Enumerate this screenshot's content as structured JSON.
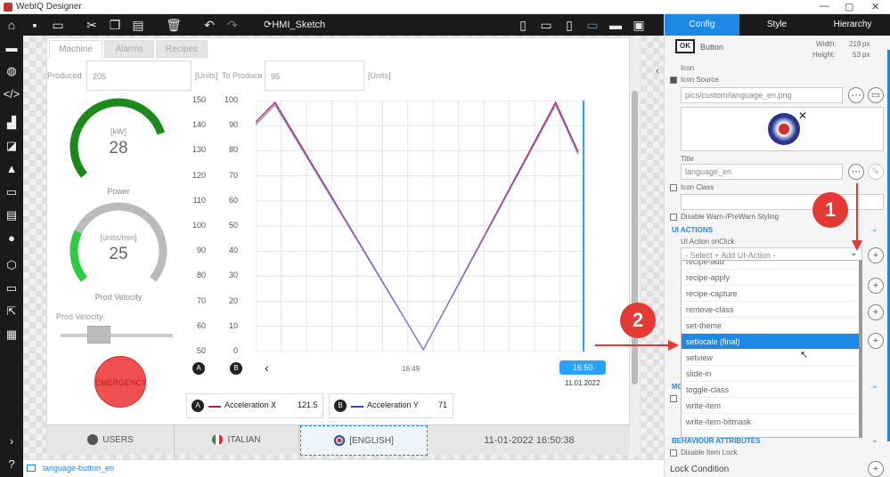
{
  "app": {
    "title": "WebIQ Designer",
    "window_controls": [
      "—",
      "▢",
      "✕"
    ]
  },
  "toolbar": {
    "project_name": "HMI_Sketch"
  },
  "hmi": {
    "tabs": [
      {
        "label": "Machine"
      },
      {
        "label": "Alarms"
      },
      {
        "label": "Recipes"
      }
    ],
    "produced_label": "Produced",
    "produced_value": "205",
    "produced_units": "[Units]",
    "to_produce_label": "To Produce",
    "to_produce_value": "95",
    "to_produce_units": "[Units]",
    "gauge_power": {
      "unit": "[kW]",
      "value": "28",
      "title": "Power",
      "fraction": 0.78,
      "color": "#1b8a1b"
    },
    "gauge_velocity": {
      "unit": "[units/min]",
      "value": "25",
      "title": "Prod Velocity",
      "fraction": 0.25,
      "color": "#2ecc40"
    },
    "slider": {
      "label": "Prod Velocity",
      "fraction": 0.3
    },
    "emergency_label": "EMERGENCY",
    "time_label": "16:49",
    "cursor_time": "16:50",
    "cursor_date": "11.01.2022",
    "legend": [
      {
        "badge": "A",
        "name": "Acceleration X",
        "value": "121.5",
        "color": "#c2185b"
      },
      {
        "badge": "B",
        "name": "Acceleration Y",
        "value": "71",
        "color": "#3949ab"
      }
    ],
    "bottom": {
      "users": "USERS",
      "italian": "ITALIAN",
      "english": "[ENGLISH]",
      "datetime": "11-01-2022 16:50:38"
    }
  },
  "chart_data": {
    "type": "line",
    "y_left_ticks": [
      "150",
      "140",
      "130",
      "120",
      "110",
      "100",
      "90",
      "80",
      "70",
      "60",
      "50"
    ],
    "y_right_ticks": [
      "100",
      "90",
      "80",
      "70",
      "60",
      "50",
      "40",
      "30",
      "20",
      "10",
      "0"
    ],
    "series": [
      {
        "name": "Acceleration X",
        "color": "#c2185b",
        "x": [
          0,
          0.06,
          0.52,
          0.93,
          1
        ],
        "y": [
          0.92,
          1,
          0,
          1,
          0.8
        ]
      },
      {
        "name": "Acceleration Y",
        "color": "#7986cb",
        "x": [
          0,
          0.06,
          0.52,
          0.93,
          1
        ],
        "y": [
          0.91,
          0.99,
          0,
          0.99,
          0.79
        ]
      }
    ]
  },
  "status": {
    "item_name": "language-button_en"
  },
  "panel": {
    "tabs": {
      "config": "Config",
      "style": "Style",
      "hierarchy": "Hierarchy"
    },
    "widget_badge": "OK",
    "widget_type": "Button",
    "width_label": "Width:",
    "width_value": "219",
    "height_label": "Height:",
    "height_value": "53",
    "unit": "px",
    "icon_label": "Icon",
    "icon_source_label": "Icon Source",
    "icon_source_value": "pics/custom/language_en.png",
    "title_label": "Title",
    "title_value": "language_en",
    "icon_class_label": "Icon Class",
    "disable_warn_label": "Disable Warn-/PreWarn Styling",
    "ui_actions_label": "UI ACTIONS",
    "onclick_label": "UI Action onClick",
    "select_placeholder": "- Select + Add UI-Action -",
    "dropdown_items": [
      "recipe-add",
      "recipe-apply",
      "recipe-capture",
      "remove-class",
      "set-theme",
      "setlocale (final)",
      "setview",
      "slide-in",
      "toggle-class",
      "write-item",
      "write-item-bitmask"
    ],
    "selected_index": 5,
    "mo_label": "MO",
    "behaviour_label": "BEHAVIOUR ATTRIBUTES",
    "disable_item_lock_label": "Disable Item Lock",
    "lock_condition_label": "Lock Condition",
    "annotations": [
      "1",
      "2"
    ]
  }
}
